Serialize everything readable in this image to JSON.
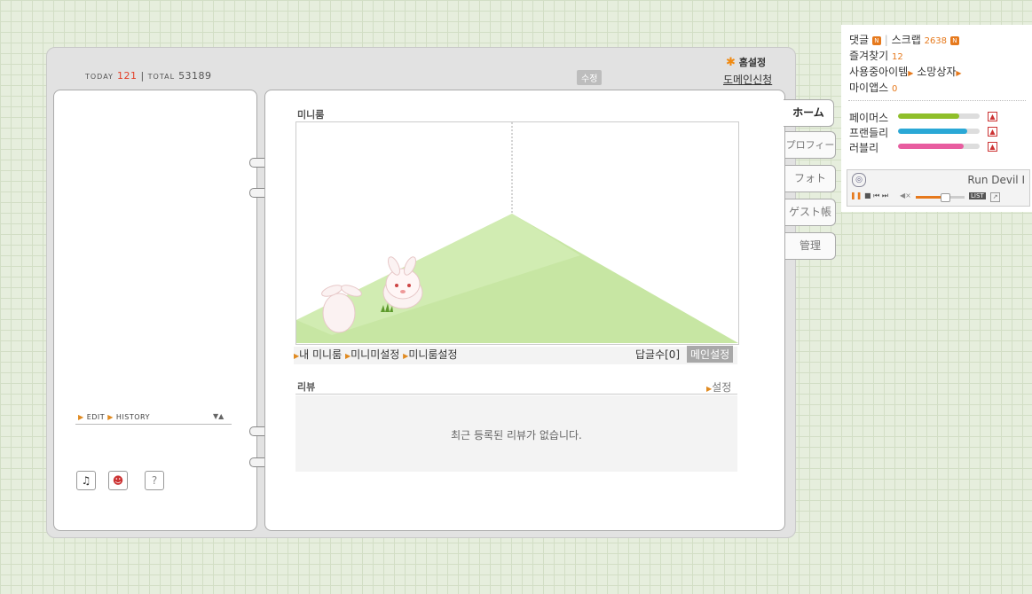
{
  "counter": {
    "today_label": "TODAY",
    "today": "121",
    "sep": "|",
    "total_label": "TOTAL",
    "total": "53189"
  },
  "header": {
    "edit_badge": "수정",
    "home_setting": "홈설정",
    "domain_apply": "도메인신청"
  },
  "left_page": {
    "edit_label": "EDIT",
    "history_label": "HISTORY"
  },
  "miniroom": {
    "title": "미니룸",
    "links": [
      "내 미니룸",
      "미니미설정",
      "미니룸설정"
    ],
    "reply_count": "답글수[0]",
    "main_setting": "메인설정"
  },
  "review": {
    "title": "리뷰",
    "setting": "설정",
    "empty_message": "최근 등록된 리뷰가 없습니다."
  },
  "tabs": [
    "ホーム",
    "プロフィール",
    "フォト",
    "ゲスト帳",
    "管理"
  ],
  "panel": {
    "comments": "댓글",
    "scrap": "스크랩",
    "scrap_count": "2638",
    "favorites": "즐겨찾기",
    "favorites_count": "12",
    "items_in_use": "사용중아이템",
    "wish_box": "소망상자",
    "my_apps": "마이앱스",
    "my_apps_count": "0",
    "badge": "N",
    "stats": [
      {
        "label": "페이머스",
        "value": 0.75,
        "color": "#8fbf2a"
      },
      {
        "label": "프랜들리",
        "value": 0.85,
        "color": "#2aa8d6"
      },
      {
        "label": "러블리",
        "value": 0.8,
        "color": "#e85da0"
      }
    ],
    "player_track": "Run Devil I",
    "player_list": "LIST"
  },
  "colors": {
    "accent": "#e6791c",
    "today": "#e3412a"
  }
}
